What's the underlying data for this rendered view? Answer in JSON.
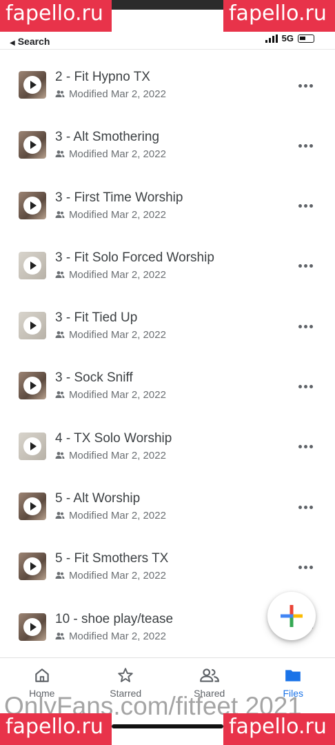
{
  "watermarks": {
    "top_left": "fapello.ru",
    "top_right": "fapello.ru",
    "bottom_left": "fapello.ru",
    "bottom_right": "fapello.ru"
  },
  "status_bar": {
    "back_label": "Search",
    "network": "5G"
  },
  "files": [
    {
      "title": "2 - Fit Hypno TX",
      "meta": "Modified Mar 2, 2022",
      "thumb": "dark"
    },
    {
      "title": "3 - Alt Smothering",
      "meta": "Modified Mar 2, 2022",
      "thumb": "dark"
    },
    {
      "title": "3 - First Time Worship",
      "meta": "Modified Mar 2, 2022",
      "thumb": "dark"
    },
    {
      "title": "3 - Fit Solo Forced Worship",
      "meta": "Modified Mar 2, 2022",
      "thumb": "light"
    },
    {
      "title": "3 - Fit Tied Up",
      "meta": "Modified Mar 2, 2022",
      "thumb": "light"
    },
    {
      "title": "3 - Sock Sniff",
      "meta": "Modified Mar 2, 2022",
      "thumb": "dark"
    },
    {
      "title": "4 - TX Solo Worship",
      "meta": "Modified Mar 2, 2022",
      "thumb": "light"
    },
    {
      "title": "5 - Alt Worship",
      "meta": "Modified Mar 2, 2022",
      "thumb": "dark"
    },
    {
      "title": "5 - Fit Smothers TX",
      "meta": "Modified Mar 2, 2022",
      "thumb": "dark"
    },
    {
      "title": "10 - shoe play/tease",
      "meta": "Modified Mar 2, 2022",
      "thumb": "dark"
    }
  ],
  "nav": {
    "home": "Home",
    "starred": "Starred",
    "shared": "Shared",
    "files": "Files",
    "active": "files"
  },
  "icons": {
    "fab": "plus-icon",
    "more": "more-horizontal-icon",
    "shared": "people-icon"
  },
  "colors": {
    "accent": "#1a73e8",
    "watermark": "#e8334a"
  },
  "footer_text": "OnlyFans.com/fitfeet 2021"
}
